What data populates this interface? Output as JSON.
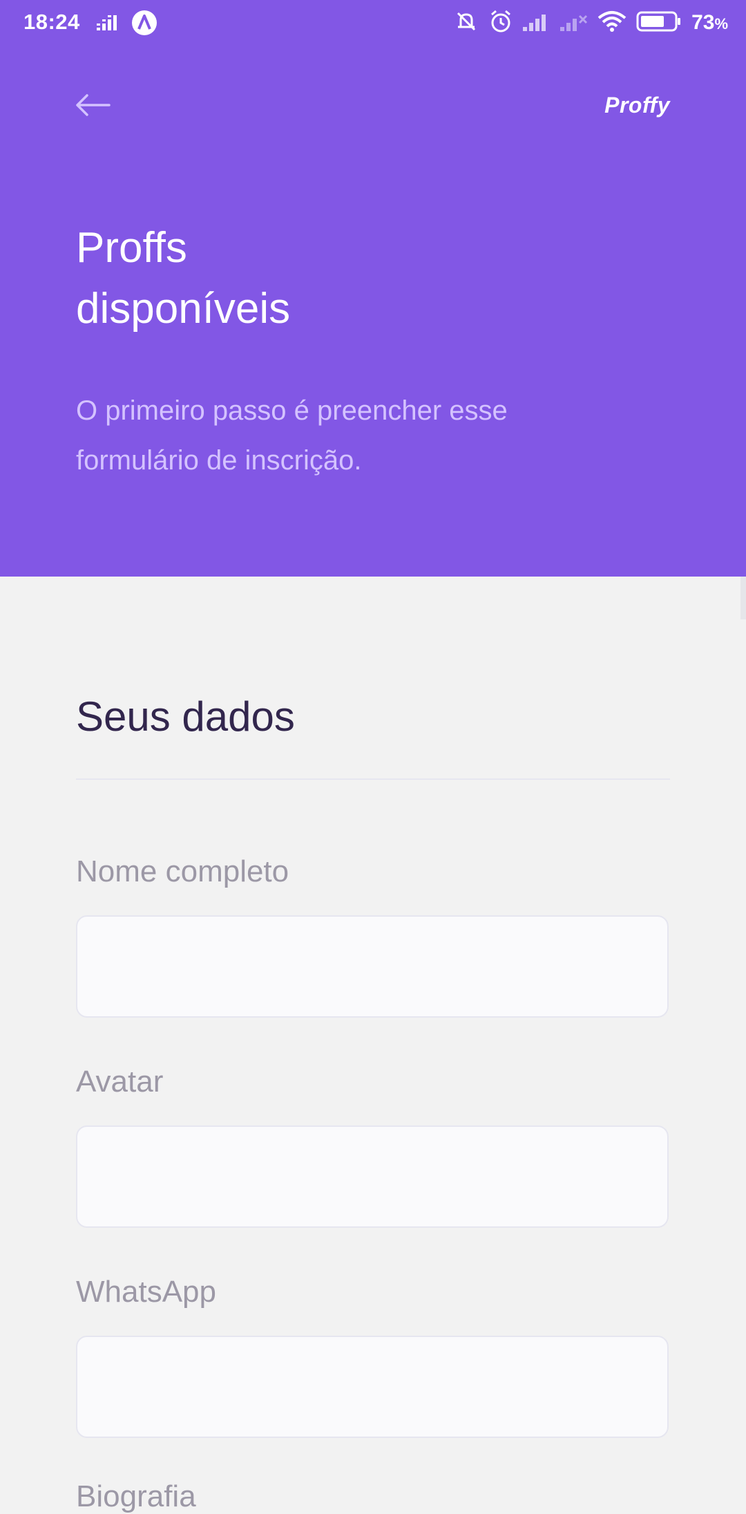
{
  "status_bar": {
    "time": "18:24",
    "battery_percent": "73",
    "battery_symbol": "%",
    "icons": [
      "equalizer-icon",
      "app-notification-icon",
      "mute-icon",
      "alarm-icon",
      "signal-icon",
      "signal-off-icon",
      "wifi-icon",
      "battery-icon"
    ]
  },
  "header": {
    "brand": "Proffy",
    "title_line1": "Proffs",
    "title_line2": "disponíveis",
    "description": "O primeiro passo é preencher esse formulário de inscrição."
  },
  "form": {
    "section_title": "Seus dados",
    "fields": [
      {
        "label": "Nome completo",
        "value": ""
      },
      {
        "label": "Avatar",
        "value": ""
      },
      {
        "label": "WhatsApp",
        "value": ""
      }
    ],
    "next_label": "Biografia"
  },
  "colors": {
    "primary": "#8257E5",
    "background": "#F2F2F2",
    "title_dark": "#32264D",
    "label": "#9C98A6",
    "input_bg": "#FAFAFC",
    "input_border": "#E6E6F0",
    "description": "#D4C2FF"
  }
}
